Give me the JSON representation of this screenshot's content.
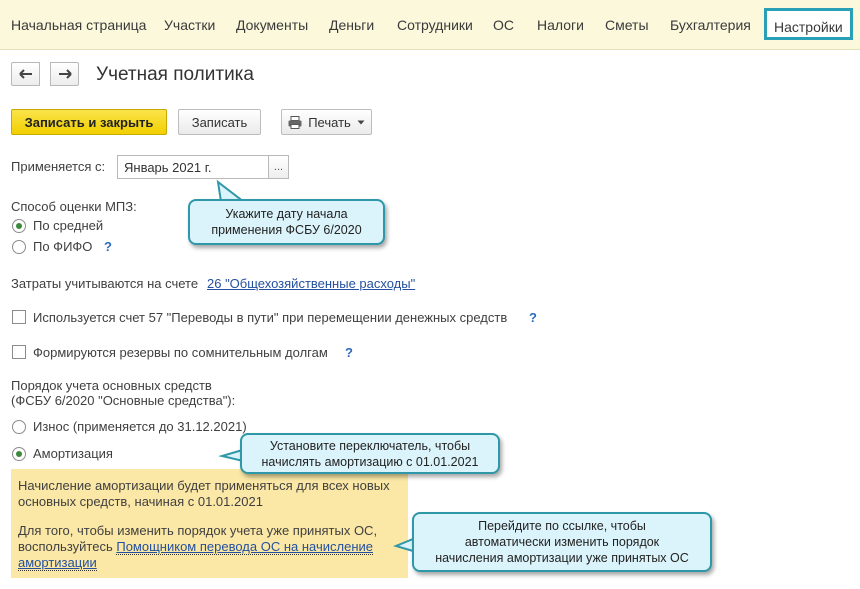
{
  "nav": {
    "items": [
      "Начальная страница",
      "Участки",
      "Документы",
      "Деньги",
      "Сотрудники",
      "ОС",
      "Налоги",
      "Сметы",
      "Бухгалтерия"
    ],
    "active": "Настройки"
  },
  "page": {
    "title": "Учетная политика"
  },
  "toolbar": {
    "save_close": "Записать и закрыть",
    "save": "Записать",
    "print": "Печать"
  },
  "applies": {
    "label": "Применяется с:",
    "value": "Январь 2021 г.",
    "dots": "..."
  },
  "mpz": {
    "label": "Способ оценки МПЗ:",
    "option1": "По средней",
    "option2": "По ФИФО",
    "selected": "По средней"
  },
  "costs": {
    "label": "Затраты учитываются на счете",
    "link": "26 \"Общехозяйственные расходы\""
  },
  "check1": {
    "label": "Используется счет 57 \"Переводы в пути\" при перемещении денежных средств",
    "checked": false
  },
  "check2": {
    "label": "Формируются резервы по сомнительным долгам",
    "checked": false
  },
  "help_mark": "?",
  "os": {
    "label_line1": "Порядок учета основных средств",
    "label_line2": "(ФСБУ 6/2020 \"Основные средства\"):",
    "option1": "Износ (применяется до 31.12.2021)",
    "option2": "Амортизация",
    "selected": "Амортизация"
  },
  "note": {
    "para1": "Начисление амортизации будет применяться для всех новых основных средств, начиная с 01.01.2021",
    "para2_line1": "Для того, чтобы изменить порядок учета уже принятых ОС,",
    "para2_prefix": "воспользуйтесь",
    "link_part1": "Помощником перевода ОС на начисление",
    "link_part2": "амортизации"
  },
  "callouts": {
    "c1_line1": "Укажите дату начала",
    "c1_line2": "применения ФСБУ 6/2020",
    "c2_line1": "Установите переключатель, чтобы",
    "c2_line2": "начислять амортизацию с 01.01.2021",
    "c3_line1": "Перейдите по ссылке, чтобы",
    "c3_line2": "автоматически изменить порядок",
    "c3_line3": "начисления амортизации уже принятых ОС"
  },
  "colors": {
    "accent": "#2aa0b7",
    "primary_button": "#f4d300",
    "note_bg": "#fbe8a6",
    "callout_bg": "#dbf4fb",
    "link": "#24509f"
  }
}
